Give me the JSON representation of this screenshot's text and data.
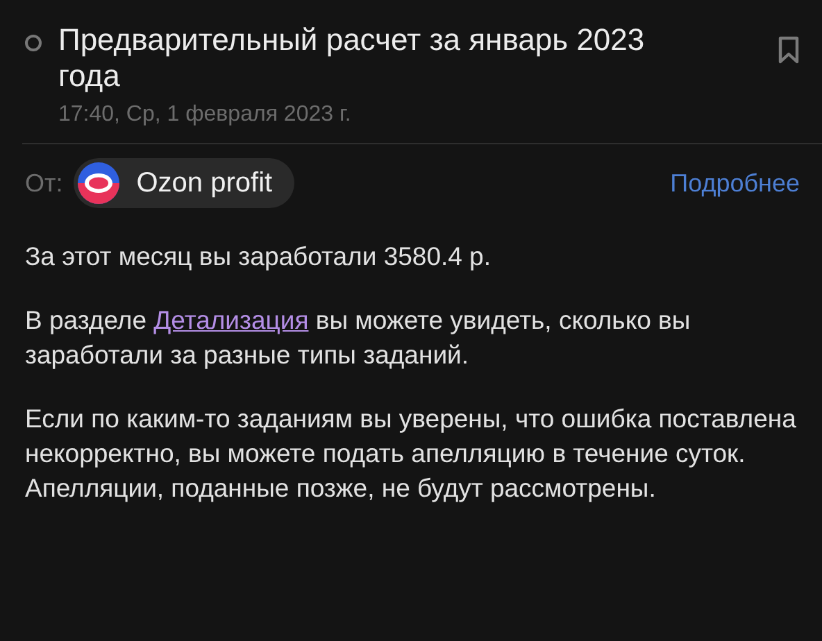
{
  "message": {
    "title": "Предварительный расчет за январь 2023 года",
    "date": "17:40, Ср, 1 февраля 2023 г."
  },
  "sender": {
    "label": "От:",
    "name": "Ozon profit",
    "details_link": "Подробнее"
  },
  "body": [
    {
      "text": "За этот месяц вы заработали 3580.4 р."
    },
    {
      "before": "В разделе ",
      "link": "Детализация",
      "after": " вы можете увидеть, сколько вы заработали за разные типы заданий."
    },
    {
      "text": "Если по каким-то заданиям вы уверены, что ошибка поставлена некорректно, вы можете подать апелляцию в течение суток. Апелляции, поданные позже, не будут рассмотрены."
    }
  ]
}
